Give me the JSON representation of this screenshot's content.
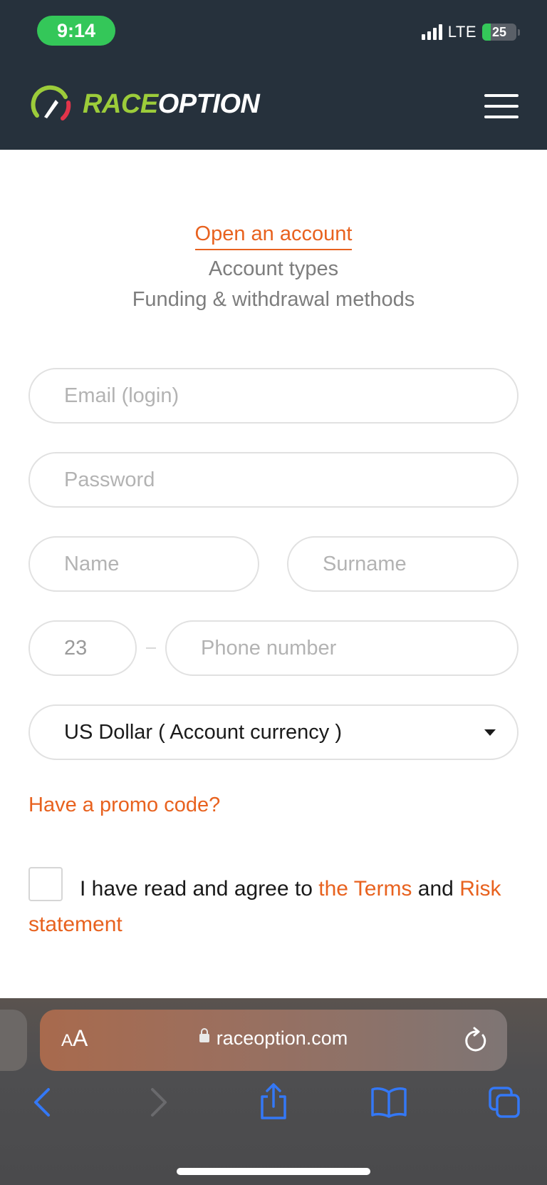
{
  "status_bar": {
    "time": "9:14",
    "network": "LTE",
    "battery": "25",
    "battery_level": 0.25
  },
  "header": {
    "logo_part1": "RACE",
    "logo_part2": "OPTION",
    "menu_icon": "hamburger-menu-icon"
  },
  "nav": {
    "active": "Open an account",
    "links": [
      "Account types",
      "Funding & withdrawal methods"
    ]
  },
  "form": {
    "email_placeholder": "Email (login)",
    "password_placeholder": "Password",
    "name_placeholder": "Name",
    "surname_placeholder": "Surname",
    "country_code_value": "23",
    "phone_placeholder": "Phone number",
    "currency_value": "US Dollar ( Account currency )",
    "promo_link": "Have a promo code?",
    "agree_prefix": "I have read and agree to",
    "terms_link": "the Terms",
    "agree_and": "and",
    "risk_link": "Risk statement"
  },
  "browser": {
    "text_size_small": "A",
    "text_size_large": "A",
    "url": "raceoption.com",
    "icons": [
      "back-icon",
      "forward-icon",
      "share-icon",
      "bookmarks-icon",
      "tabs-icon",
      "reload-icon",
      "lock-icon"
    ]
  },
  "colors": {
    "accent": "#e8621f",
    "header_bg": "#26313c",
    "brand_green": "#9ccc3a",
    "ios_blue": "#3478f6"
  }
}
